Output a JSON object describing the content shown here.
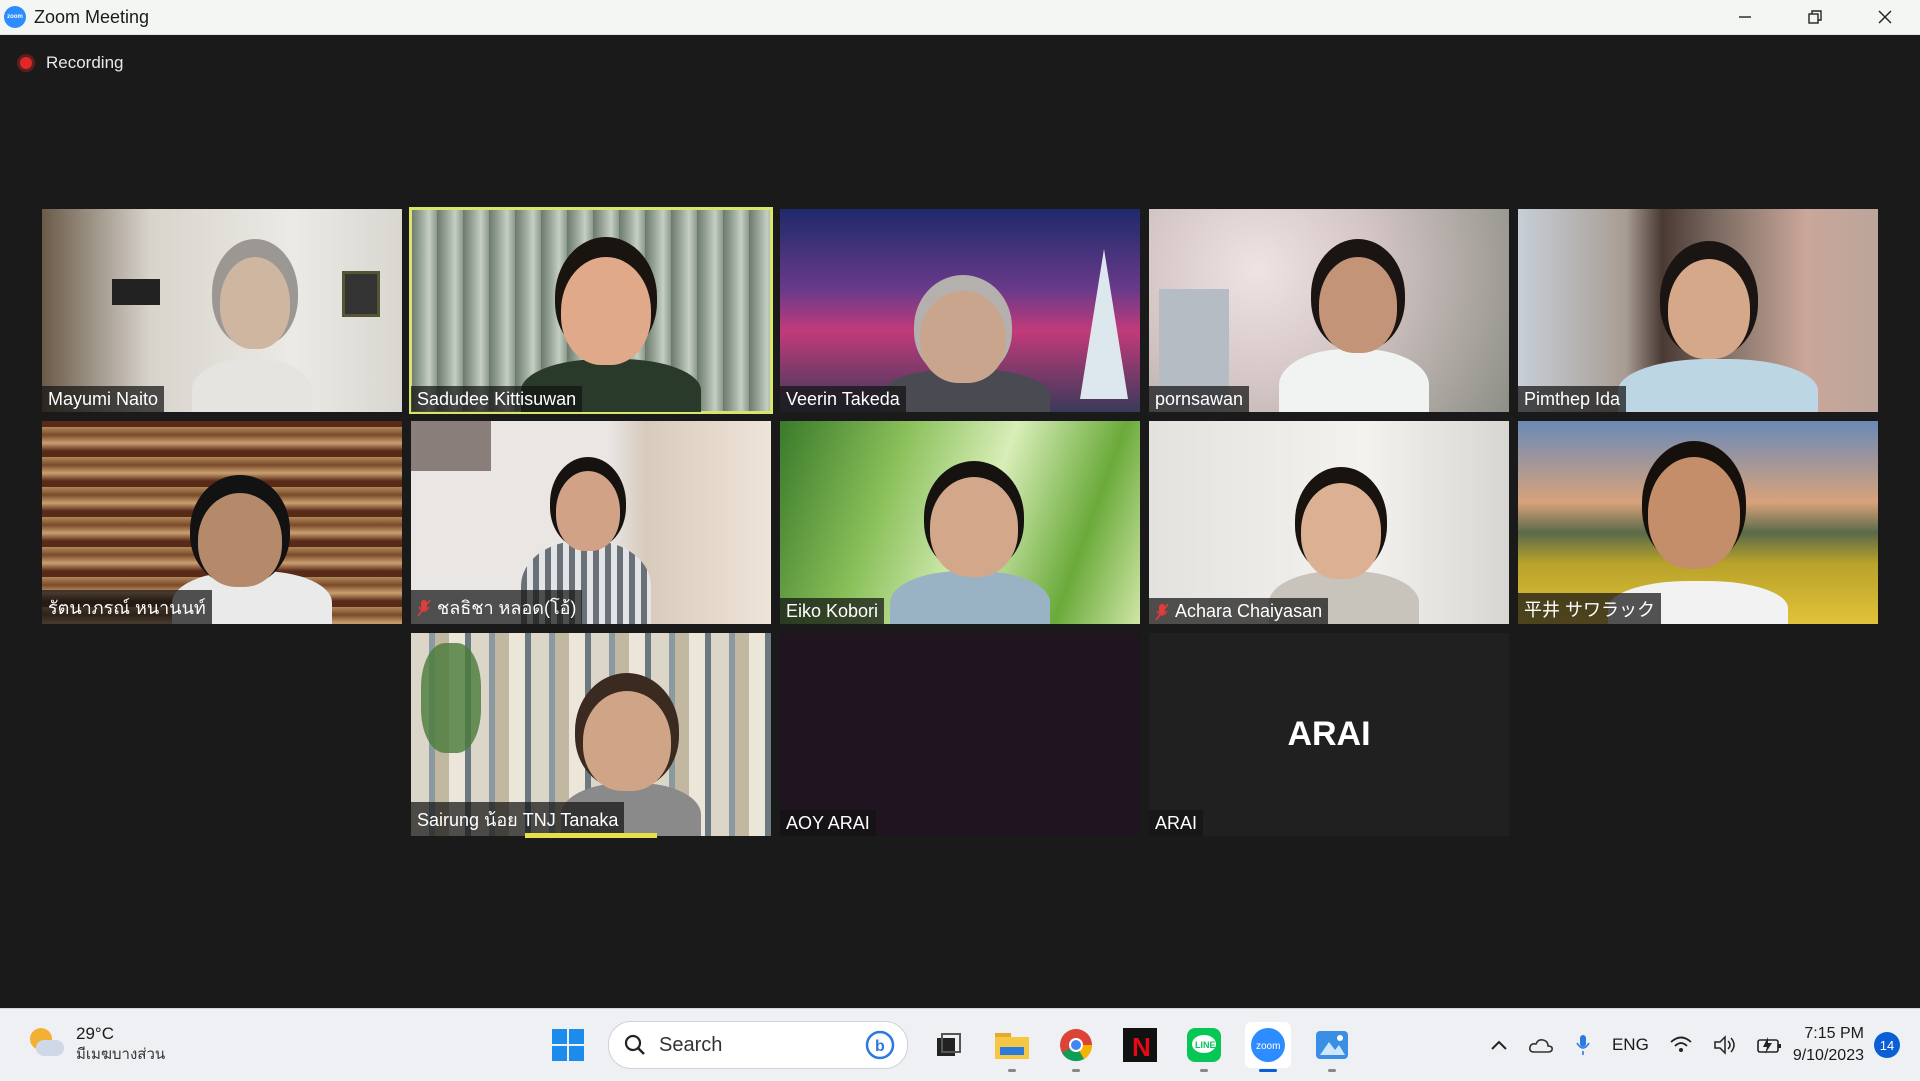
{
  "window": {
    "title": "Zoom Meeting"
  },
  "meeting": {
    "recording_label": "Recording",
    "participants": [
      {
        "name": "Mayumi Naito",
        "muted": false
      },
      {
        "name": "Sadudee Kittisuwan",
        "muted": false,
        "active_speaker": true
      },
      {
        "name": "Veerin Takeda",
        "muted": false
      },
      {
        "name": "pornsawan",
        "muted": false
      },
      {
        "name": "Pimthep Ida",
        "muted": false
      },
      {
        "name": "รัตนาภรณ์ หนานนท์",
        "muted": false
      },
      {
        "name": "ชลธิชา หลอด(โอ้)",
        "muted": true
      },
      {
        "name": "Eiko Kobori",
        "muted": false
      },
      {
        "name": "Achara Chaiyasan",
        "muted": true
      },
      {
        "name": "平井 サワラック",
        "muted": false
      },
      {
        "name": "Sairung น้อย TNJ Tanaka",
        "muted": false
      },
      {
        "name": "AOY ARAI",
        "muted": false
      },
      {
        "name": "ARAI",
        "muted": false,
        "video_off_label": "ARAI"
      }
    ]
  },
  "taskbar": {
    "weather": {
      "temp": "29°C",
      "condition": "มีเมฆบางส่วน"
    },
    "search_placeholder": "Search",
    "apps": [
      "windows-start",
      "search",
      "task-view",
      "file-explorer",
      "chrome",
      "netflix",
      "line",
      "zoom",
      "photos"
    ],
    "tray": {
      "language": "ENG",
      "time": "7:15 PM",
      "date": "9/10/2023",
      "notification_count": "14"
    }
  },
  "colors": {
    "active_speaker_border": "#d9e66a",
    "zoom_blue": "#2d8cff",
    "recording_red": "#e02828"
  }
}
